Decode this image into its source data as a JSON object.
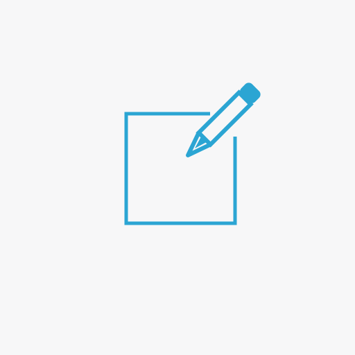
{
  "icon": {
    "name": "edit-icon",
    "parts": [
      "square-outline",
      "pencil"
    ],
    "color": "#2ba5d3",
    "background": "#f7f7f8"
  }
}
